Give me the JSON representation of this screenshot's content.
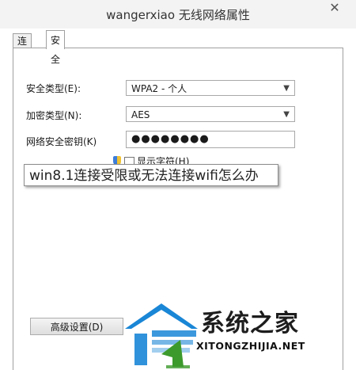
{
  "window": {
    "title": "wangerxiao 无线网络属性",
    "close_glyph": "✕"
  },
  "tabs": [
    {
      "label": "连接",
      "active": false
    },
    {
      "label": "安全",
      "active": true
    }
  ],
  "form": {
    "security_type": {
      "label": "安全类型(E):",
      "value": "WPA2 - 个人"
    },
    "encryption_type": {
      "label": "加密类型(N):",
      "value": "AES"
    },
    "network_key": {
      "label": "网络安全密钥(K)",
      "value": "●●●●●●●●"
    },
    "show_chars": {
      "label": "显示字符(H)",
      "checked": false
    }
  },
  "overlay_caption": "win8.1连接受限或无法连接wifi怎么办",
  "advanced_button": "高级设置(D)",
  "watermark": {
    "text": "系统之家",
    "url": "XITONGZHIJIA.NET"
  },
  "colors": {
    "watermark_blue": "#1a86d6",
    "watermark_green": "#3c9a2c"
  }
}
